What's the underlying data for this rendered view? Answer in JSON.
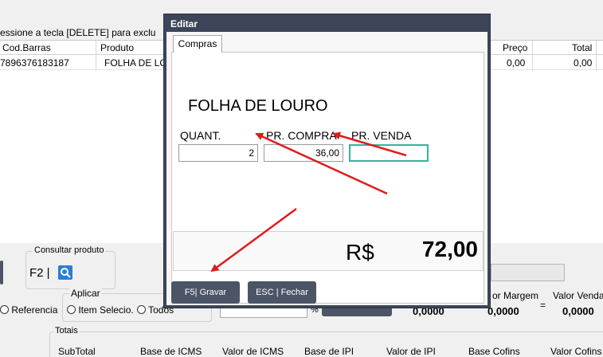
{
  "background": {
    "hint_text": "essione a tecla  [DELETE] para exclu",
    "grid": {
      "headers": [
        "Cod.Barras",
        "Produto",
        "Preço",
        "Total"
      ],
      "row": {
        "barcode": "7896376183187",
        "product": "FOLHA DE LO",
        "price": "0,00",
        "total": "0,00"
      }
    },
    "consult": {
      "title": "Consultar produto",
      "shortcut": "F2 |"
    },
    "apply": {
      "title": "Aplicar",
      "options": [
        "Referencia",
        "Item Selecio.",
        "Todos"
      ]
    },
    "percent_sign": "%",
    "margin": {
      "label": "or Margem",
      "value": "0,0000",
      "eq": "=",
      "value2": "0,0000"
    },
    "venda": {
      "label": "Valor Venda",
      "value": "0,0000"
    },
    "left_value": "0,0000",
    "totals": {
      "title": "Totais",
      "columns": [
        "SubTotal",
        "Base de ICMS",
        "Valor de ICMS",
        "Base de IPI",
        "Valor de IPI",
        "Base Cofins",
        "Valor Cofins"
      ]
    }
  },
  "dialog": {
    "title": "Editar",
    "tab": "Compras",
    "product_name": "FOLHA DE LOURO",
    "fields": {
      "quant_label": "QUANT.",
      "quant_value": "2",
      "pr_compra_label": "PR. COMPRA",
      "pr_compra_value": "36,00",
      "pr_venda_label": "PR. VENDA",
      "pr_venda_value": ""
    },
    "total": {
      "currency": "R$",
      "amount": "72,00"
    },
    "buttons": {
      "save": "F5| Gravar",
      "close": "ESC | Fechar"
    }
  },
  "colors": {
    "dialog_frame": "#3c4658",
    "focus_border": "#33b49a",
    "arrow": "#e01b1b",
    "button_bg": "#4b5566"
  }
}
